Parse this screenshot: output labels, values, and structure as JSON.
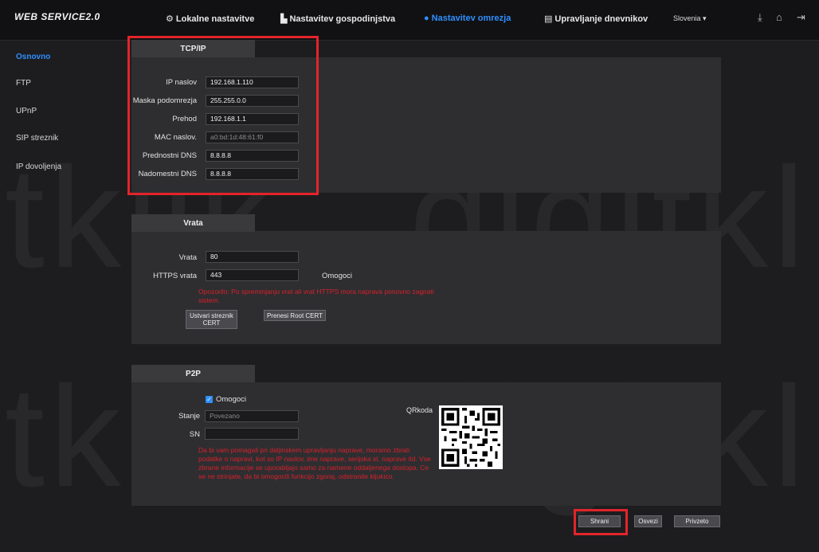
{
  "brand": "WEB SERVICE2.0",
  "nav": [
    {
      "label": "Lokalne nastavitve",
      "icon": "gear-icon",
      "glyph": "⚙"
    },
    {
      "label": "Nastavitev gospodinjstva",
      "icon": "building-icon",
      "glyph": "▙"
    },
    {
      "label": "Nastavitev omrezja",
      "icon": "globe-icon",
      "glyph": "●"
    },
    {
      "label": "Upravljanje dnevnikov",
      "icon": "log-icon",
      "glyph": "▤"
    }
  ],
  "language": "Slovenia",
  "sidebar": [
    {
      "label": "Osnovno"
    },
    {
      "label": "FTP"
    },
    {
      "label": "UPnP"
    },
    {
      "label": "SIP streznik"
    },
    {
      "label": "IP dovoljenja"
    }
  ],
  "tcpip": {
    "title": "TCP/IP",
    "fields": [
      {
        "label": "IP naslov",
        "value": "192.168.1.110"
      },
      {
        "label": "Maska podomrezja",
        "value": "255.255.0.0"
      },
      {
        "label": "Prehod",
        "value": "192.168.1.1"
      },
      {
        "label": "MAC naslov.",
        "value": "a0:bd:1d:48:61:f0"
      },
      {
        "label": "Prednostni DNS",
        "value": "8.8.8.8"
      },
      {
        "label": "Nadomestni DNS",
        "value": "8.8.8.8"
      }
    ]
  },
  "vrata": {
    "title": "Vrata",
    "port_label": "Vrata",
    "port_value": "80",
    "https_label": "HTTPS vrata",
    "https_value": "443",
    "enable_label": "Omogoci",
    "warning": "Opozorilo: Po spreminjanju vrat ali vrat HTTPS mora naprava ponovno zagnati sistem.",
    "create_cert_label": "Ustvari streznik CERT",
    "upload_cert_label": "Prenesi Root CERT"
  },
  "p2p": {
    "title": "P2P",
    "enable_label": "Omogoci",
    "status_label": "Stanje",
    "status_value": "Povezano",
    "sn_label": "SN",
    "sn_value": "",
    "qr_label": "QRkoda",
    "notice": "Da bi vam pomagali pri daljinskem upravljanju naprave, moramo zbrati podatke o napravi, kot so IP naslov, ime naprave, serijska st. naprave itd. Vse zbrane informacije se uporabljajo samo za namene oddaljenega dostopa. Ce se ne strinjate, da bi omogocili funkcijo zgoraj, odstranite kljukico."
  },
  "actions": {
    "save": "Shrani",
    "refresh": "Osvezi",
    "default": "Privzeto"
  },
  "watermark": "itklik digitkli",
  "accent_color": "#2f8fff",
  "warning_color": "#d8202a",
  "highlight_color": "#e3242b"
}
